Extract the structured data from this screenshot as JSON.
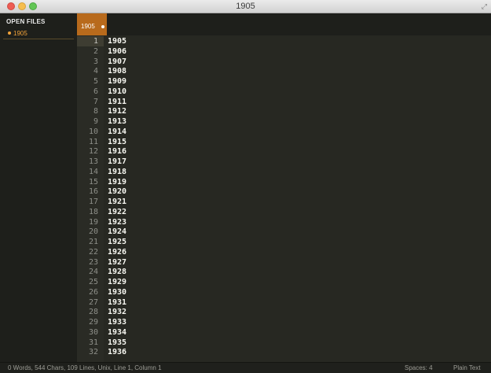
{
  "window": {
    "title": "1905"
  },
  "sidebar": {
    "header": "OPEN FILES",
    "items": [
      {
        "label": "1905"
      }
    ]
  },
  "tabs": [
    {
      "label": "1905"
    }
  ],
  "editor": {
    "lines": [
      {
        "n": "1",
        "t": "1905"
      },
      {
        "n": "2",
        "t": "1906"
      },
      {
        "n": "3",
        "t": "1907"
      },
      {
        "n": "4",
        "t": "1908"
      },
      {
        "n": "5",
        "t": "1909"
      },
      {
        "n": "6",
        "t": "1910"
      },
      {
        "n": "7",
        "t": "1911"
      },
      {
        "n": "8",
        "t": "1912"
      },
      {
        "n": "9",
        "t": "1913"
      },
      {
        "n": "10",
        "t": "1914"
      },
      {
        "n": "11",
        "t": "1915"
      },
      {
        "n": "12",
        "t": "1916"
      },
      {
        "n": "13",
        "t": "1917"
      },
      {
        "n": "14",
        "t": "1918"
      },
      {
        "n": "15",
        "t": "1919"
      },
      {
        "n": "16",
        "t": "1920"
      },
      {
        "n": "17",
        "t": "1921"
      },
      {
        "n": "18",
        "t": "1922"
      },
      {
        "n": "19",
        "t": "1923"
      },
      {
        "n": "20",
        "t": "1924"
      },
      {
        "n": "21",
        "t": "1925"
      },
      {
        "n": "22",
        "t": "1926"
      },
      {
        "n": "23",
        "t": "1927"
      },
      {
        "n": "24",
        "t": "1928"
      },
      {
        "n": "25",
        "t": "1929"
      },
      {
        "n": "26",
        "t": "1930"
      },
      {
        "n": "27",
        "t": "1931"
      },
      {
        "n": "28",
        "t": "1932"
      },
      {
        "n": "29",
        "t": "1933"
      },
      {
        "n": "30",
        "t": "1934"
      },
      {
        "n": "31",
        "t": "1935"
      },
      {
        "n": "32",
        "t": "1936"
      }
    ]
  },
  "statusbar": {
    "left": "0 Words, 544 Chars, 109 Lines, Unix, Line 1, Column 1",
    "spaces": "Spaces: 4",
    "syntax": "Plain Text"
  },
  "colors": {
    "accent": "#b86a1c",
    "sidebar_active": "#f2a33a",
    "editor_bg": "#272822"
  }
}
